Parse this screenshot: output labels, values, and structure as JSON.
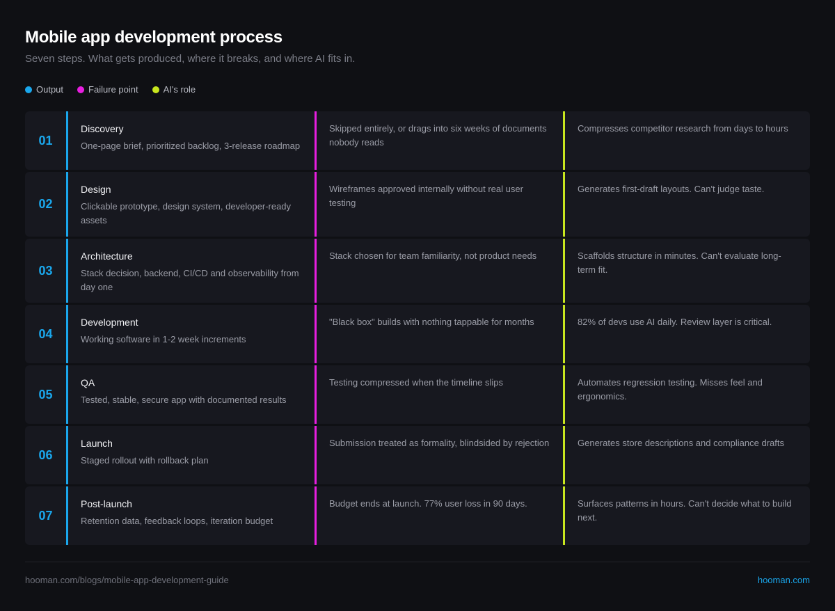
{
  "header": {
    "title": "Mobile app development process",
    "subtitle": "Seven steps. What gets produced, where it breaks, and where AI fits in."
  },
  "colors": {
    "output": "#1aa7ec",
    "failure": "#e81ee0",
    "ai": "#c8e61e",
    "brand": "#1aa7ec"
  },
  "legend": [
    {
      "label": "Output",
      "color": "#1aa7ec"
    },
    {
      "label": "Failure point",
      "color": "#e81ee0"
    },
    {
      "label": "AI's role",
      "color": "#c8e61e"
    }
  ],
  "steps": [
    {
      "num": "01",
      "name": "Discovery",
      "output": "One-page brief, prioritized backlog, 3-release roadmap",
      "failure": "Skipped entirely, or drags into six weeks of documents nobody reads",
      "ai": "Compresses competitor research from days to hours"
    },
    {
      "num": "02",
      "name": "Design",
      "output": "Clickable prototype, design system, developer-ready assets",
      "failure": "Wireframes approved internally without real user testing",
      "ai": "Generates first-draft layouts. Can't judge taste."
    },
    {
      "num": "03",
      "name": "Architecture",
      "output": "Stack decision, backend, CI/CD and observability from day one",
      "failure": "Stack chosen for team familiarity, not product needs",
      "ai": "Scaffolds structure in minutes. Can't evaluate long-term fit."
    },
    {
      "num": "04",
      "name": "Development",
      "output": "Working software in 1-2 week increments",
      "failure": "\"Black box\" builds with nothing tappable for months",
      "ai": "82% of devs use AI daily. Review layer is critical."
    },
    {
      "num": "05",
      "name": "QA",
      "output": "Tested, stable, secure app with documented results",
      "failure": "Testing compressed when the timeline slips",
      "ai": "Automates regression testing. Misses feel and ergonomics."
    },
    {
      "num": "06",
      "name": "Launch",
      "output": "Staged rollout with rollback plan",
      "failure": "Submission treated as formality, blindsided by rejection",
      "ai": "Generates store descriptions and compliance drafts"
    },
    {
      "num": "07",
      "name": "Post-launch",
      "output": "Retention data, feedback loops, iteration budget",
      "failure": "Budget ends at launch. 77% user loss in 90 days.",
      "ai": "Surfaces patterns in hours. Can't decide what to build next."
    }
  ],
  "footer": {
    "url": "hooman.com/blogs/mobile-app-development-guide",
    "brand": "hooman.com"
  }
}
